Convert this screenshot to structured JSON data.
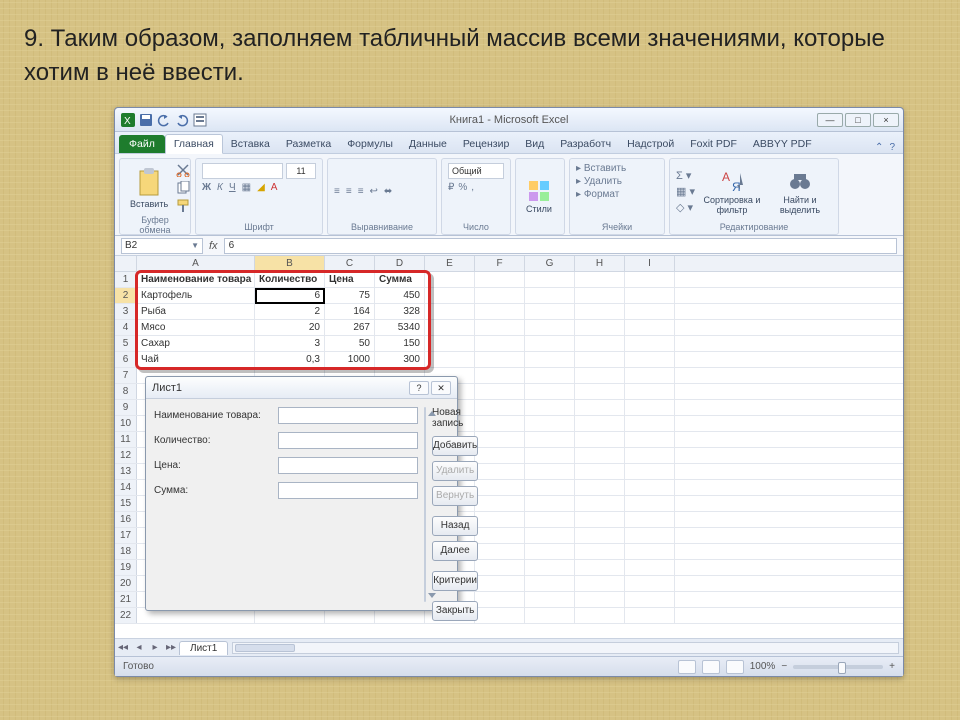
{
  "slide": {
    "text": "9. Таким образом, заполняем табличный массив всеми значениями, которые хотим в неё ввести."
  },
  "window": {
    "title": "Книга1 - Microsoft Excel",
    "win_min": "—",
    "win_max": "□",
    "win_close": "×"
  },
  "ribbon": {
    "file": "Файл",
    "tabs": [
      "Главная",
      "Вставка",
      "Разметка",
      "Формулы",
      "Данные",
      "Рецензир",
      "Вид",
      "Разработч",
      "Надстрой",
      "Foxit PDF",
      "ABBYY PDF"
    ],
    "groups": {
      "clipboard": {
        "paste": "Вставить",
        "label": "Буфер обмена"
      },
      "font": {
        "size": "11",
        "label": "Шрифт"
      },
      "align": {
        "label": "Выравнивание"
      },
      "number": {
        "format": "Общий",
        "label": "Число"
      },
      "styles": {
        "btn": "Стили"
      },
      "cells": {
        "insert": "Вставить",
        "delete": "Удалить",
        "format": "Формат",
        "label": "Ячейки"
      },
      "editing": {
        "sort": "Сортировка и фильтр",
        "find": "Найти и выделить",
        "label": "Редактирование"
      }
    }
  },
  "fx": {
    "name_box": "B2",
    "formula": "6"
  },
  "columns": [
    "A",
    "B",
    "C",
    "D",
    "E",
    "F",
    "G",
    "H",
    "I"
  ],
  "headers": [
    "Наименование товара",
    "Количество",
    "Цена",
    "Сумма"
  ],
  "rows": [
    {
      "name": "Картофель",
      "qty": "6",
      "price": "75",
      "sum": "450"
    },
    {
      "name": "Рыба",
      "qty": "2",
      "price": "164",
      "sum": "328"
    },
    {
      "name": "Мясо",
      "qty": "20",
      "price": "267",
      "sum": "5340"
    },
    {
      "name": "Сахар",
      "qty": "3",
      "price": "50",
      "sum": "150"
    },
    {
      "name": "Чай",
      "qty": "0,3",
      "price": "1000",
      "sum": "300"
    }
  ],
  "dialog": {
    "title": "Лист1",
    "new_record": "Новая запись",
    "fields": [
      "Наименование товара:",
      "Количество:",
      "Цена:",
      "Сумма:"
    ],
    "buttons": {
      "add": "Добавить",
      "delete": "Удалить",
      "restore": "Вернуть",
      "prev": "Назад",
      "next": "Далее",
      "criteria": "Критерии",
      "close": "Закрыть"
    }
  },
  "sheets": {
    "nav": [
      "◂◂",
      "◂",
      "▸",
      "▸▸"
    ],
    "tab": "Лист1"
  },
  "status": {
    "ready": "Готово",
    "zoom": "100%",
    "minus": "−",
    "plus": "+"
  }
}
